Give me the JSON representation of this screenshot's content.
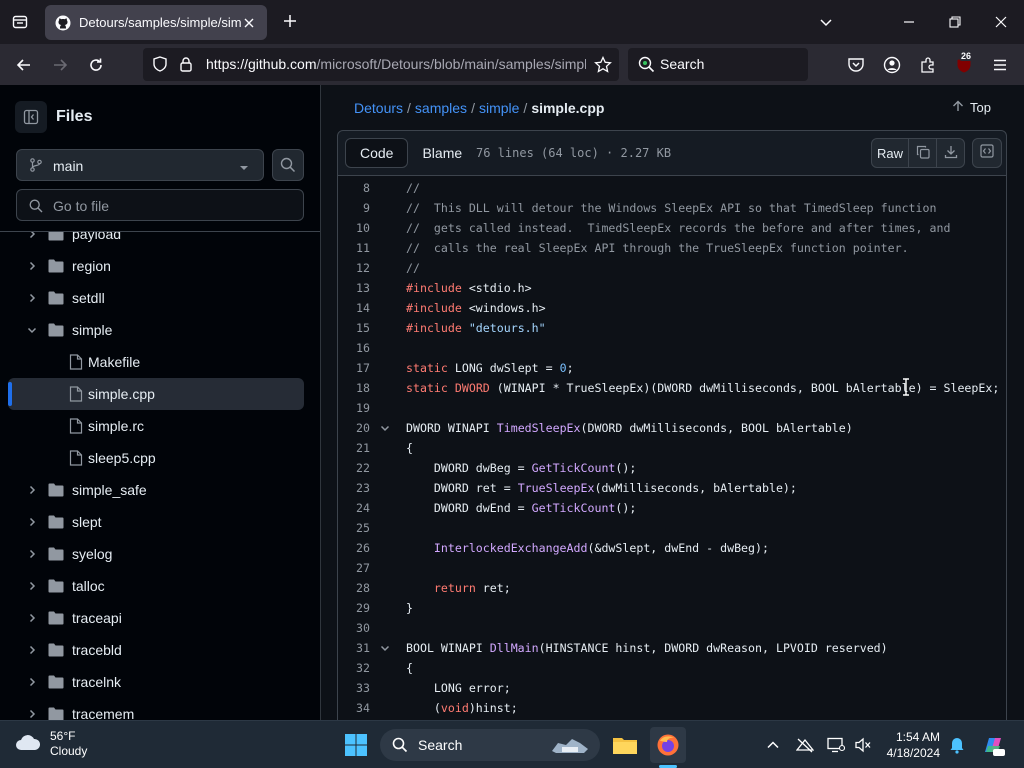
{
  "browser": {
    "tab_title": "Detours/samples/simple/simple.cpp",
    "url_host": "https://github.com",
    "url_path": "/microsoft/Detours/blob/main/samples/simple/simple.cpp",
    "search_placeholder": "Search",
    "extensions_badge": "26"
  },
  "sidebar": {
    "title": "Files",
    "branch": "main",
    "goto_placeholder": "Go to file",
    "tree": [
      {
        "label": "payload",
        "type": "folder",
        "level": 0,
        "expanded": false
      },
      {
        "label": "region",
        "type": "folder",
        "level": 0,
        "expanded": false
      },
      {
        "label": "setdll",
        "type": "folder",
        "level": 0,
        "expanded": false
      },
      {
        "label": "simple",
        "type": "folder",
        "level": 0,
        "expanded": true
      },
      {
        "label": "Makefile",
        "type": "file",
        "level": 1
      },
      {
        "label": "simple.cpp",
        "type": "file",
        "level": 1,
        "selected": true
      },
      {
        "label": "simple.rc",
        "type": "file",
        "level": 1
      },
      {
        "label": "sleep5.cpp",
        "type": "file",
        "level": 1
      },
      {
        "label": "simple_safe",
        "type": "folder",
        "level": 0,
        "expanded": false
      },
      {
        "label": "slept",
        "type": "folder",
        "level": 0,
        "expanded": false
      },
      {
        "label": "syelog",
        "type": "folder",
        "level": 0,
        "expanded": false
      },
      {
        "label": "talloc",
        "type": "folder",
        "level": 0,
        "expanded": false
      },
      {
        "label": "traceapi",
        "type": "folder",
        "level": 0,
        "expanded": false
      },
      {
        "label": "tracebld",
        "type": "folder",
        "level": 0,
        "expanded": false
      },
      {
        "label": "tracelnk",
        "type": "folder",
        "level": 0,
        "expanded": false
      },
      {
        "label": "tracemem",
        "type": "folder",
        "level": 0,
        "expanded": false
      }
    ]
  },
  "main": {
    "breadcrumb": [
      "Detours",
      "samples",
      "simple"
    ],
    "breadcrumb_sep": "/",
    "current_file": "simple.cpp",
    "top_label": "Top",
    "tabs": [
      "Code",
      "Blame"
    ],
    "file_meta": "76 lines (64 loc) · 2.27 KB",
    "raw_label": "Raw",
    "code": [
      {
        "n": "8",
        "tokens": [
          [
            "c",
            "//"
          ]
        ]
      },
      {
        "n": "9",
        "tokens": [
          [
            "c",
            "//  This DLL will detour the Windows SleepEx API so that TimedSleep function"
          ]
        ]
      },
      {
        "n": "10",
        "tokens": [
          [
            "c",
            "//  gets called instead.  TimedSleepEx records the before and after times, and"
          ]
        ]
      },
      {
        "n": "11",
        "tokens": [
          [
            "c",
            "//  calls the real SleepEx API through the TrueSleepEx function pointer."
          ]
        ]
      },
      {
        "n": "12",
        "tokens": [
          [
            "c",
            "//"
          ]
        ]
      },
      {
        "n": "13",
        "tokens": [
          [
            "k",
            "#include"
          ],
          [
            "p",
            " <stdio.h>"
          ]
        ]
      },
      {
        "n": "14",
        "tokens": [
          [
            "k",
            "#include"
          ],
          [
            "p",
            " <windows.h>"
          ]
        ]
      },
      {
        "n": "15",
        "tokens": [
          [
            "k",
            "#include"
          ],
          [
            "p",
            " "
          ],
          [
            "s",
            "\"detours.h\""
          ]
        ]
      },
      {
        "n": "16",
        "tokens": []
      },
      {
        "n": "17",
        "tokens": [
          [
            "k",
            "static"
          ],
          [
            "p",
            " LONG dwSlept = "
          ],
          [
            "n",
            "0"
          ],
          [
            "p",
            ";"
          ]
        ]
      },
      {
        "n": "18",
        "tokens": [
          [
            "k",
            "static"
          ],
          [
            "p",
            " "
          ],
          [
            "k",
            "DWORD"
          ],
          [
            "p",
            " (WINAPI * TrueSleepEx)(DWORD dwMilliseconds, BOOL bAlertable) = SleepEx;"
          ]
        ]
      },
      {
        "n": "19",
        "tokens": []
      },
      {
        "n": "20",
        "fold": true,
        "tokens": [
          [
            "p",
            "DWORD WINAPI "
          ],
          [
            "f",
            "TimedSleepEx"
          ],
          [
            "p",
            "(DWORD dwMilliseconds, BOOL bAlertable)"
          ]
        ]
      },
      {
        "n": "21",
        "tokens": [
          [
            "p",
            "{"
          ]
        ]
      },
      {
        "n": "22",
        "tokens": [
          [
            "p",
            "    DWORD dwBeg = "
          ],
          [
            "f",
            "GetTickCount"
          ],
          [
            "p",
            "();"
          ]
        ]
      },
      {
        "n": "23",
        "tokens": [
          [
            "p",
            "    DWORD ret = "
          ],
          [
            "f",
            "TrueSleepEx"
          ],
          [
            "p",
            "(dwMilliseconds, bAlertable);"
          ]
        ]
      },
      {
        "n": "24",
        "tokens": [
          [
            "p",
            "    DWORD dwEnd = "
          ],
          [
            "f",
            "GetTickCount"
          ],
          [
            "p",
            "();"
          ]
        ]
      },
      {
        "n": "25",
        "tokens": []
      },
      {
        "n": "26",
        "tokens": [
          [
            "p",
            "    "
          ],
          [
            "f",
            "InterlockedExchangeAdd"
          ],
          [
            "p",
            "(&dwSlept, dwEnd - dwBeg);"
          ]
        ]
      },
      {
        "n": "27",
        "tokens": []
      },
      {
        "n": "28",
        "tokens": [
          [
            "p",
            "    "
          ],
          [
            "k",
            "return"
          ],
          [
            "p",
            " ret;"
          ]
        ]
      },
      {
        "n": "29",
        "tokens": [
          [
            "p",
            "}"
          ]
        ]
      },
      {
        "n": "30",
        "tokens": []
      },
      {
        "n": "31",
        "fold": true,
        "tokens": [
          [
            "p",
            "BOOL WINAPI "
          ],
          [
            "f",
            "DllMain"
          ],
          [
            "p",
            "(HINSTANCE hinst, DWORD dwReason, LPVOID reserved)"
          ]
        ]
      },
      {
        "n": "32",
        "tokens": [
          [
            "p",
            "{"
          ]
        ]
      },
      {
        "n": "33",
        "tokens": [
          [
            "p",
            "    LONG error;"
          ]
        ]
      },
      {
        "n": "34",
        "tokens": [
          [
            "p",
            "    ("
          ],
          [
            "k",
            "void"
          ],
          [
            "p",
            ")hinst;"
          ]
        ]
      }
    ]
  },
  "taskbar": {
    "temperature": "56°F",
    "condition": "Cloudy",
    "search_label": "Search",
    "time": "1:54 AM",
    "date": "4/18/2024"
  },
  "colors": {
    "accent": "#4493f8",
    "selected_bar": "#1f6feb",
    "keyword": "#ff7b72",
    "function": "#d2a8ff",
    "string": "#a5d6ff",
    "number": "#79c0ff",
    "comment": "#9198a1"
  }
}
